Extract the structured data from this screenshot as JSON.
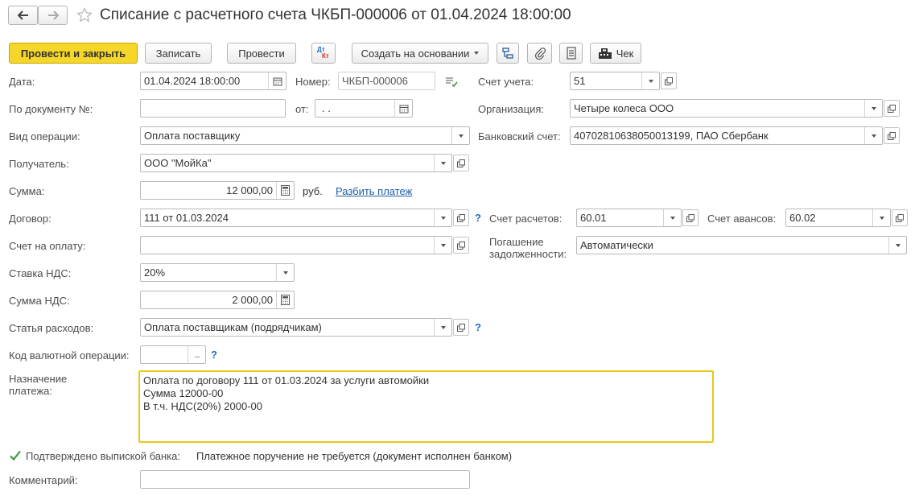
{
  "window": {
    "title": "Списание с расчетного счета ЧКБП-000006 от 01.04.2024 18:00:00"
  },
  "toolbar": {
    "post_close": "Провести и закрыть",
    "save": "Записать",
    "post": "Провести",
    "dt_kt_top": "Дт",
    "dt_kt_bottom": "Кт",
    "create_based": "Создать на основании",
    "receipt": "Чек"
  },
  "form": {
    "date_label": "Дата:",
    "date_value": "01.04.2024 18:00:00",
    "number_label": "Номер:",
    "number_value": "ЧКБП-000006",
    "account_label": "Счет учета:",
    "account_value": "51",
    "doc_no_label": "По документу №:",
    "doc_no_value": "",
    "from_label": "от:",
    "from_value": " .  .",
    "org_label": "Организация:",
    "org_value": "Четыре колеса ООО",
    "op_type_label": "Вид операции:",
    "op_type_value": "Оплата поставщику",
    "bank_account_label": "Банковский счет:",
    "bank_account_value": "40702810638050013199, ПАО Сбербанк",
    "recipient_label": "Получатель:",
    "recipient_value": "ООО \"МойКа\"",
    "amount_label": "Сумма:",
    "amount_value": "12 000,00",
    "currency": "руб.",
    "split_payment": "Разбить платеж",
    "contract_label": "Договор:",
    "contract_value": "111 от 01.03.2024",
    "settle_account_label": "Счет расчетов:",
    "settle_account_value": "60.01",
    "advance_account_label": "Счет авансов:",
    "advance_account_value": "60.02",
    "invoice_label": "Счет на оплату:",
    "invoice_value": "",
    "debt_label_1": "Погашение",
    "debt_label_2": "задолженности:",
    "debt_value": "Автоматически",
    "vat_rate_label": "Ставка НДС:",
    "vat_rate_value": "20%",
    "vat_amount_label": "Сумма НДС:",
    "vat_amount_value": "2 000,00",
    "expense_label": "Статья расходов:",
    "expense_value": "Оплата поставщикам (подрядчикам)",
    "currency_op_label": "Код валютной операции:",
    "currency_op_value": "",
    "purpose_label_1": "Назначение",
    "purpose_label_2": "платежа:",
    "purpose_line1": "Оплата по договору 111 от 01.03.2024 за услуги автомойки",
    "purpose_line2": "Сумма 12000-00",
    "purpose_line3": "В т.ч. НДС(20%) 2000-00",
    "confirmed_label": "Подтверждено выпиской банка:",
    "confirmed_note": "Платежное поручение не требуется (документ исполнен банком)",
    "comment_label": "Комментарий:",
    "comment_value": "",
    "help": "?"
  },
  "colors": {
    "primary_button": "#f5d629",
    "highlight_border": "#e8c81a",
    "link": "#1c5ea6",
    "checkbox_mark": "#3a9a3a"
  }
}
